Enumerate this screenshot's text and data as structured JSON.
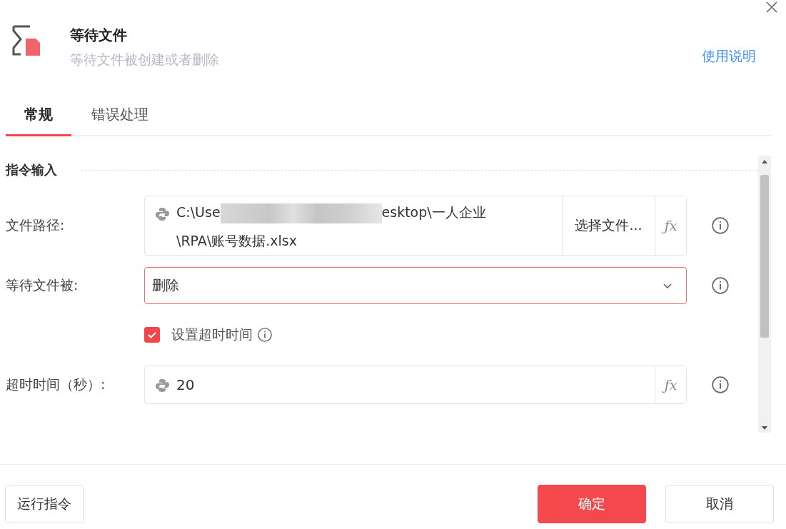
{
  "header": {
    "title": "等待文件",
    "subtitle": "等待文件被创建或者删除",
    "help_link": "使用说明"
  },
  "tabs": [
    {
      "label": "常规",
      "selected": true
    },
    {
      "label": "错误处理",
      "selected": false
    }
  ],
  "section": {
    "title": "指令输入"
  },
  "fields": [
    {
      "kind": "path",
      "label": "文件路径:",
      "value_start": "C:\\Use",
      "value_line1_end": "esktop\\一人企业",
      "value_line2": "\\RPA\\账号数据.xlsx",
      "redacted": true,
      "button": "选择文件...",
      "fx": "ƒx"
    },
    {
      "kind": "select",
      "label": "等待文件被:",
      "value": "删除",
      "focused": true
    },
    {
      "kind": "checkbox",
      "label": "设置超时时间",
      "checked": true
    },
    {
      "kind": "number",
      "label": "超时时间（秒）:",
      "value": "20",
      "fx": "ƒx"
    }
  ],
  "footer": {
    "run_button": "运行指令",
    "ok_button": "确定",
    "cancel_button": "取消"
  }
}
